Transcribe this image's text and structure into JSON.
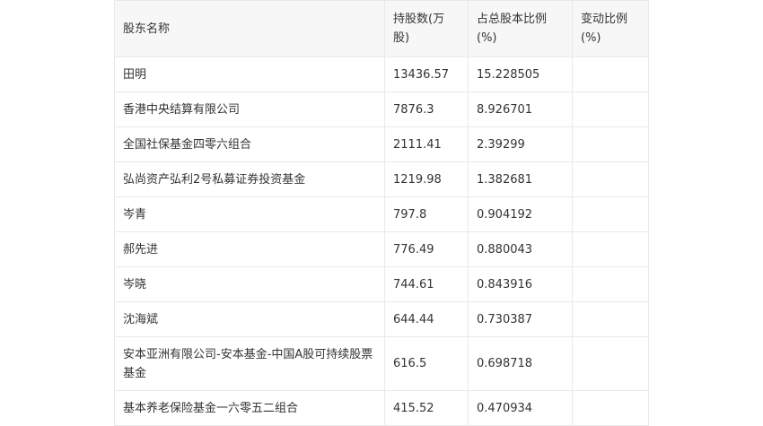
{
  "table": {
    "headers": [
      "股东名称",
      "持股数(万股)",
      "占总股本比例(%)",
      "变动比例(%)"
    ],
    "rows": [
      {
        "name": "田明",
        "shares": "13436.57",
        "ratio": "15.228505",
        "change": ""
      },
      {
        "name": "香港中央结算有限公司",
        "shares": "7876.3",
        "ratio": "8.926701",
        "change": ""
      },
      {
        "name": "全国社保基金四零六组合",
        "shares": "2111.41",
        "ratio": "2.39299",
        "change": ""
      },
      {
        "name": "弘尚资产弘利2号私募证券投资基金",
        "shares": "1219.98",
        "ratio": "1.382681",
        "change": ""
      },
      {
        "name": "岑青",
        "shares": "797.8",
        "ratio": "0.904192",
        "change": ""
      },
      {
        "name": "郝先进",
        "shares": "776.49",
        "ratio": "0.880043",
        "change": ""
      },
      {
        "name": "岑晓",
        "shares": "744.61",
        "ratio": "0.843916",
        "change": ""
      },
      {
        "name": "沈海斌",
        "shares": "644.44",
        "ratio": "0.730387",
        "change": ""
      },
      {
        "name": "安本亚洲有限公司-安本基金-中国A股可持续股票基金",
        "shares": "616.5",
        "ratio": "0.698718",
        "change": ""
      },
      {
        "name": "基本养老保险基金一六零五二组合",
        "shares": "415.52",
        "ratio": "0.470934",
        "change": ""
      }
    ]
  }
}
